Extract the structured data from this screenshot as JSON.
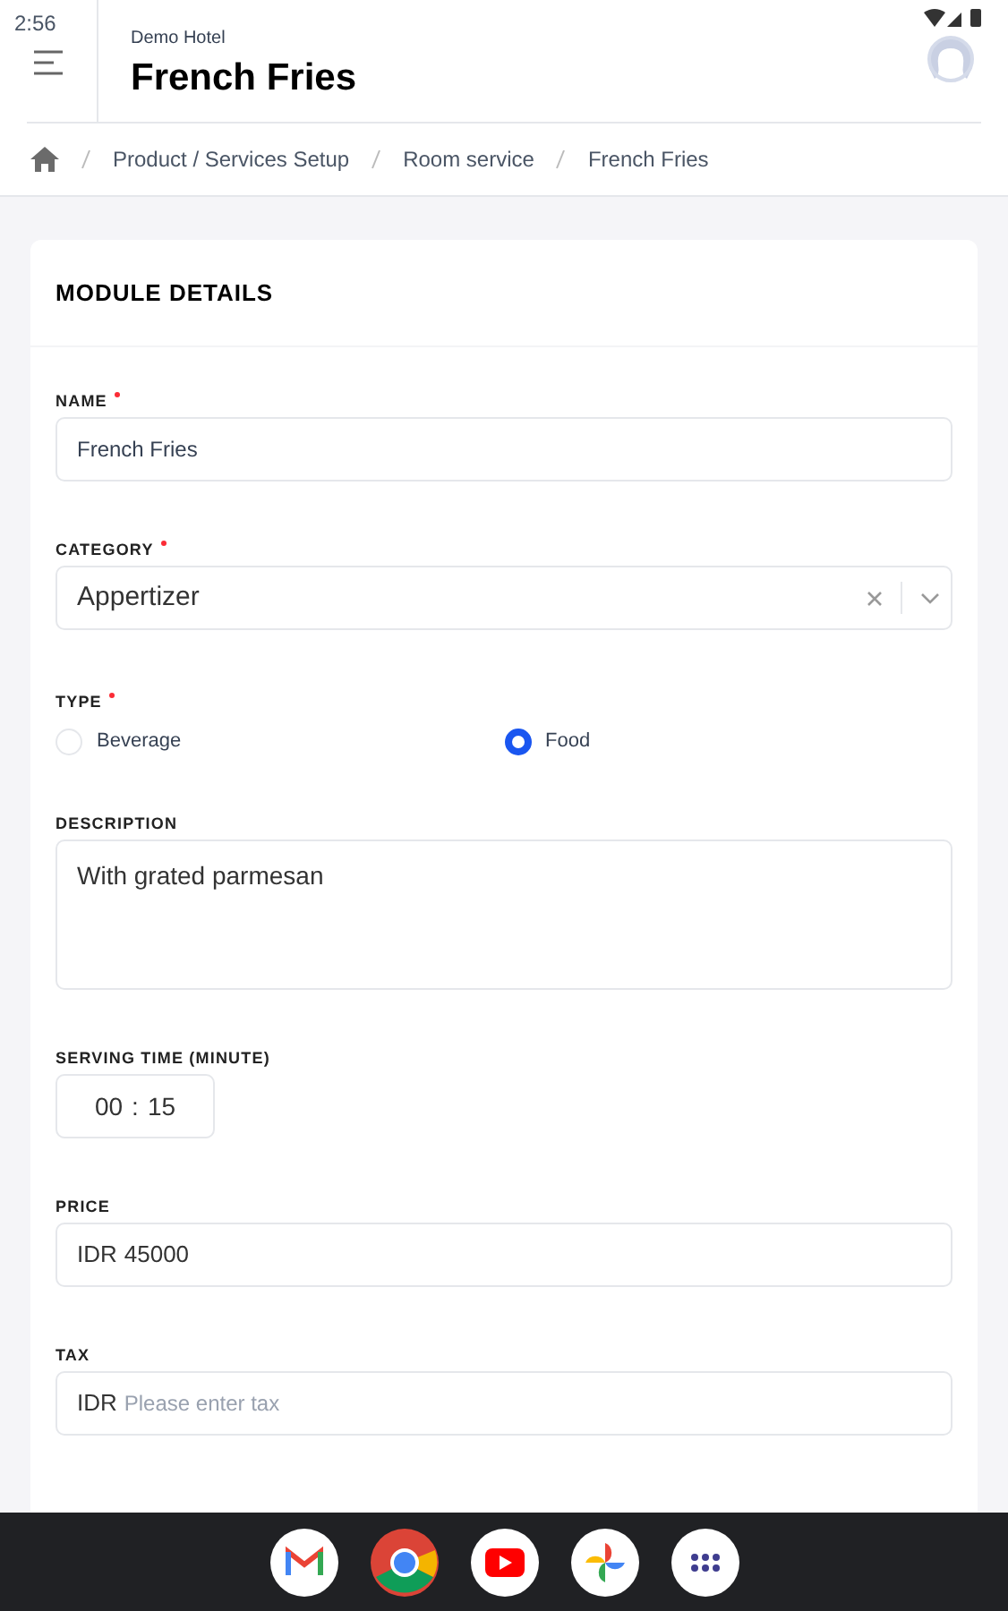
{
  "status_bar": {
    "time": "2:56"
  },
  "header": {
    "subtitle": "Demo Hotel",
    "title": "French Fries"
  },
  "breadcrumb": [
    "Product / Services Setup",
    "Room service",
    "French Fries"
  ],
  "card": {
    "title": "MODULE DETAILS",
    "fields": [
      {
        "kind": "text",
        "label": "NAME",
        "required": true,
        "value": "French Fries"
      },
      {
        "kind": "select",
        "label": "CATEGORY",
        "required": true,
        "value": "Appertizer"
      },
      {
        "kind": "radio",
        "label": "TYPE",
        "required": true,
        "options": [
          {
            "label": "Beverage",
            "selected": false
          },
          {
            "label": "Food",
            "selected": true
          }
        ]
      },
      {
        "kind": "textarea",
        "label": "DESCRIPTION",
        "required": false,
        "value": "With grated parmesan"
      },
      {
        "kind": "time",
        "label": "SERVING TIME (MINUTE)",
        "required": false,
        "hours": "00",
        "separator": ":",
        "minutes": "15"
      },
      {
        "kind": "currency",
        "label": "PRICE",
        "required": false,
        "prefix": "IDR",
        "value": "45000"
      },
      {
        "kind": "currency",
        "label": "TAX",
        "required": false,
        "prefix": "IDR",
        "placeholder": "Please enter tax"
      }
    ]
  }
}
